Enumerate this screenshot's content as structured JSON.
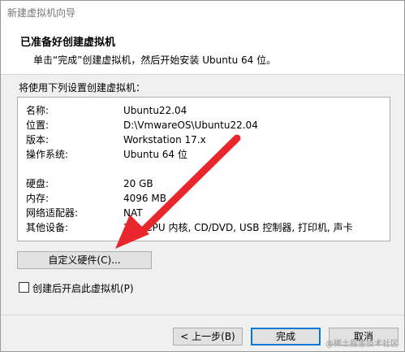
{
  "window": {
    "title": "新建虚拟机向导"
  },
  "header": {
    "title": "已准备好创建虚拟机",
    "subtitle": "单击“完成”创建虚拟机，然后开始安装 Ubuntu 64 位。"
  },
  "intro": "将使用下列设置创建虚拟机：",
  "summary": [
    {
      "key": "名称:",
      "value": "Ubuntu22.04"
    },
    {
      "key": "位置:",
      "value": "D:\\VmwareOS\\Ubuntu22.04"
    },
    {
      "key": "版本:",
      "value": "Workstation 17.x"
    },
    {
      "key": "操作系统:",
      "value": "Ubuntu 64 位"
    },
    {
      "key": "硬盘:",
      "value": "20 GB"
    },
    {
      "key": "内存:",
      "value": "4096 MB"
    },
    {
      "key": "网络适配器:",
      "value": "NAT"
    },
    {
      "key": "其他设备:",
      "value": "2 个 CPU 内核, CD/DVD, USB 控制器, 打印机, 声卡"
    }
  ],
  "customize_label": "自定义硬件(C)...",
  "power_on_label": "创建后开启此虚拟机(P)",
  "power_on_checked": false,
  "buttons": {
    "back": "< 上一步(B)",
    "finish": "完成",
    "cancel": "取消"
  },
  "watermark": "@稀土掘金技术社区",
  "colors": {
    "arrow": "#e8262b",
    "focus": "#0078d7"
  }
}
